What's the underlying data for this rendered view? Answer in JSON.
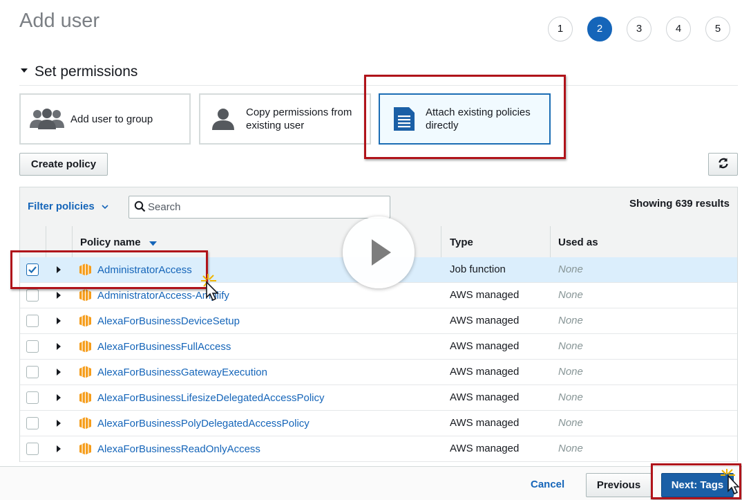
{
  "header": {
    "title": "Add user",
    "steps": [
      "1",
      "2",
      "3",
      "4",
      "5"
    ],
    "active_step": "2"
  },
  "permissions": {
    "section_title": "Set permissions",
    "options": [
      {
        "label": "Add user to group",
        "icon": "group-icon"
      },
      {
        "label": "Copy permissions from existing user",
        "icon": "user-icon"
      },
      {
        "label": "Attach existing policies directly",
        "icon": "document-icon",
        "selected": true
      }
    ],
    "create_policy": "Create policy",
    "refresh_icon": "refresh-icon"
  },
  "table": {
    "filter_label": "Filter policies",
    "search_placeholder": "Search",
    "results": "Showing 639 results",
    "columns": {
      "name": "Policy name",
      "type": "Type",
      "used_as": "Used as"
    },
    "rows": [
      {
        "name": "AdministratorAccess",
        "type": "Job function",
        "used_as": "None",
        "checked": true
      },
      {
        "name": "AdministratorAccess-Amplify",
        "type": "AWS managed",
        "used_as": "None",
        "checked": false
      },
      {
        "name": "AlexaForBusinessDeviceSetup",
        "type": "AWS managed",
        "used_as": "None",
        "checked": false
      },
      {
        "name": "AlexaForBusinessFullAccess",
        "type": "AWS managed",
        "used_as": "None",
        "checked": false
      },
      {
        "name": "AlexaForBusinessGatewayExecution",
        "type": "AWS managed",
        "used_as": "None",
        "checked": false
      },
      {
        "name": "AlexaForBusinessLifesizeDelegatedAccessPolicy",
        "type": "AWS managed",
        "used_as": "None",
        "checked": false
      },
      {
        "name": "AlexaForBusinessPolyDelegatedAccessPolicy",
        "type": "AWS managed",
        "used_as": "None",
        "checked": false
      },
      {
        "name": "AlexaForBusinessReadOnlyAccess",
        "type": "AWS managed",
        "used_as": "None",
        "checked": false
      }
    ]
  },
  "footer": {
    "cancel": "Cancel",
    "previous": "Previous",
    "next": "Next: Tags"
  },
  "colors": {
    "primary": "#1a5fa6",
    "link": "#1565b9",
    "highlight": "#b0131a",
    "policy_icon": "#f59c1a"
  }
}
